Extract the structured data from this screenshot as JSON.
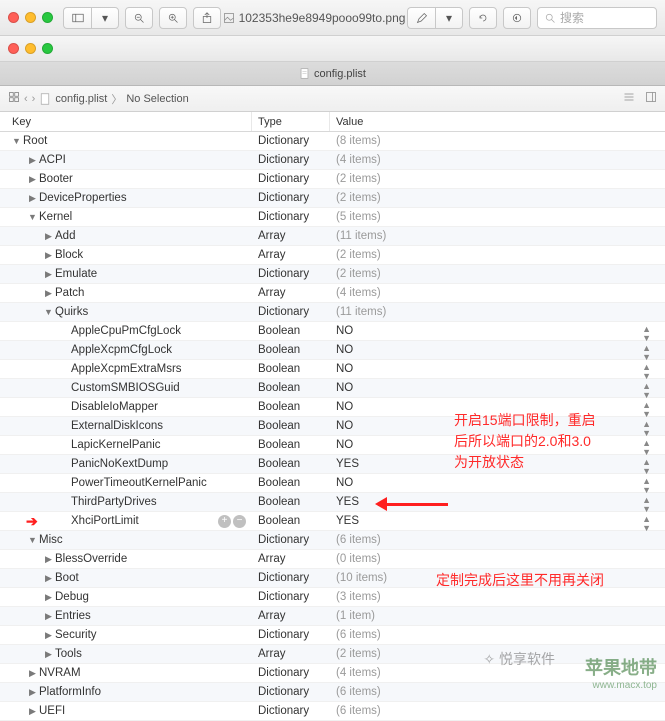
{
  "top_filename": "102353he9e8949pooo99to.png",
  "search_placeholder": "搜索",
  "tab_filename": "config.plist",
  "breadcrumb_file": "config.plist",
  "breadcrumb_sel": "No Selection",
  "columns": {
    "key": "Key",
    "type": "Type",
    "value": "Value"
  },
  "rows": [
    {
      "indent": 0,
      "tri": "down",
      "key": "Root",
      "type": "Dictionary",
      "val": "(8 items)",
      "muted": true
    },
    {
      "indent": 1,
      "tri": "right",
      "key": "ACPI",
      "type": "Dictionary",
      "val": "(4 items)",
      "muted": true
    },
    {
      "indent": 1,
      "tri": "right",
      "key": "Booter",
      "type": "Dictionary",
      "val": "(2 items)",
      "muted": true
    },
    {
      "indent": 1,
      "tri": "right",
      "key": "DeviceProperties",
      "type": "Dictionary",
      "val": "(2 items)",
      "muted": true
    },
    {
      "indent": 1,
      "tri": "down",
      "key": "Kernel",
      "type": "Dictionary",
      "val": "(5 items)",
      "muted": true
    },
    {
      "indent": 2,
      "tri": "right",
      "key": "Add",
      "type": "Array",
      "val": "(11 items)",
      "muted": true
    },
    {
      "indent": 2,
      "tri": "right",
      "key": "Block",
      "type": "Array",
      "val": "(2 items)",
      "muted": true
    },
    {
      "indent": 2,
      "tri": "right",
      "key": "Emulate",
      "type": "Dictionary",
      "val": "(2 items)",
      "muted": true
    },
    {
      "indent": 2,
      "tri": "right",
      "key": "Patch",
      "type": "Array",
      "val": "(4 items)",
      "muted": true
    },
    {
      "indent": 2,
      "tri": "down",
      "key": "Quirks",
      "type": "Dictionary",
      "val": "(11 items)",
      "muted": true
    },
    {
      "indent": 3,
      "tri": "",
      "key": "AppleCpuPmCfgLock",
      "type": "Boolean",
      "val": "NO",
      "updown": true
    },
    {
      "indent": 3,
      "tri": "",
      "key": "AppleXcpmCfgLock",
      "type": "Boolean",
      "val": "NO",
      "updown": true
    },
    {
      "indent": 3,
      "tri": "",
      "key": "AppleXcpmExtraMsrs",
      "type": "Boolean",
      "val": "NO",
      "updown": true
    },
    {
      "indent": 3,
      "tri": "",
      "key": "CustomSMBIOSGuid",
      "type": "Boolean",
      "val": "NO",
      "updown": true
    },
    {
      "indent": 3,
      "tri": "",
      "key": "DisableIoMapper",
      "type": "Boolean",
      "val": "NO",
      "updown": true
    },
    {
      "indent": 3,
      "tri": "",
      "key": "ExternalDiskIcons",
      "type": "Boolean",
      "val": "NO",
      "updown": true
    },
    {
      "indent": 3,
      "tri": "",
      "key": "LapicKernelPanic",
      "type": "Boolean",
      "val": "NO",
      "updown": true
    },
    {
      "indent": 3,
      "tri": "",
      "key": "PanicNoKextDump",
      "type": "Boolean",
      "val": "YES",
      "updown": true
    },
    {
      "indent": 3,
      "tri": "",
      "key": "PowerTimeoutKernelPanic",
      "type": "Boolean",
      "val": "NO",
      "updown": true
    },
    {
      "indent": 3,
      "tri": "",
      "key": "ThirdPartyDrives",
      "type": "Boolean",
      "val": "YES",
      "updown": true
    },
    {
      "indent": 3,
      "tri": "",
      "key": "XhciPortLimit",
      "type": "Boolean",
      "val": "YES",
      "updown": true,
      "highlight": true,
      "addrem": true
    },
    {
      "indent": 1,
      "tri": "down",
      "key": "Misc",
      "type": "Dictionary",
      "val": "(6 items)",
      "muted": true
    },
    {
      "indent": 2,
      "tri": "right",
      "key": "BlessOverride",
      "type": "Array",
      "val": "(0 items)",
      "muted": true
    },
    {
      "indent": 2,
      "tri": "right",
      "key": "Boot",
      "type": "Dictionary",
      "val": "(10 items)",
      "muted": true
    },
    {
      "indent": 2,
      "tri": "right",
      "key": "Debug",
      "type": "Dictionary",
      "val": "(3 items)",
      "muted": true
    },
    {
      "indent": 2,
      "tri": "right",
      "key": "Entries",
      "type": "Array",
      "val": "(1 item)",
      "muted": true
    },
    {
      "indent": 2,
      "tri": "right",
      "key": "Security",
      "type": "Dictionary",
      "val": "(6 items)",
      "muted": true
    },
    {
      "indent": 2,
      "tri": "right",
      "key": "Tools",
      "type": "Array",
      "val": "(2 items)",
      "muted": true
    },
    {
      "indent": 1,
      "tri": "right",
      "key": "NVRAM",
      "type": "Dictionary",
      "val": "(4 items)",
      "muted": true
    },
    {
      "indent": 1,
      "tri": "right",
      "key": "PlatformInfo",
      "type": "Dictionary",
      "val": "(6 items)",
      "muted": true
    },
    {
      "indent": 1,
      "tri": "right",
      "key": "UEFI",
      "type": "Dictionary",
      "val": "(6 items)",
      "muted": true
    }
  ],
  "annot1_line1": "开启15端口限制，重启",
  "annot1_line2": "后所以端口的2.0和3.0",
  "annot1_line3": "为开放状态",
  "annot2": "定制完成后这里不用再关闭",
  "watermark_name": "苹果地带",
  "watermark_url": "www.macx.top",
  "watermark2": "✧ 悦享软件"
}
